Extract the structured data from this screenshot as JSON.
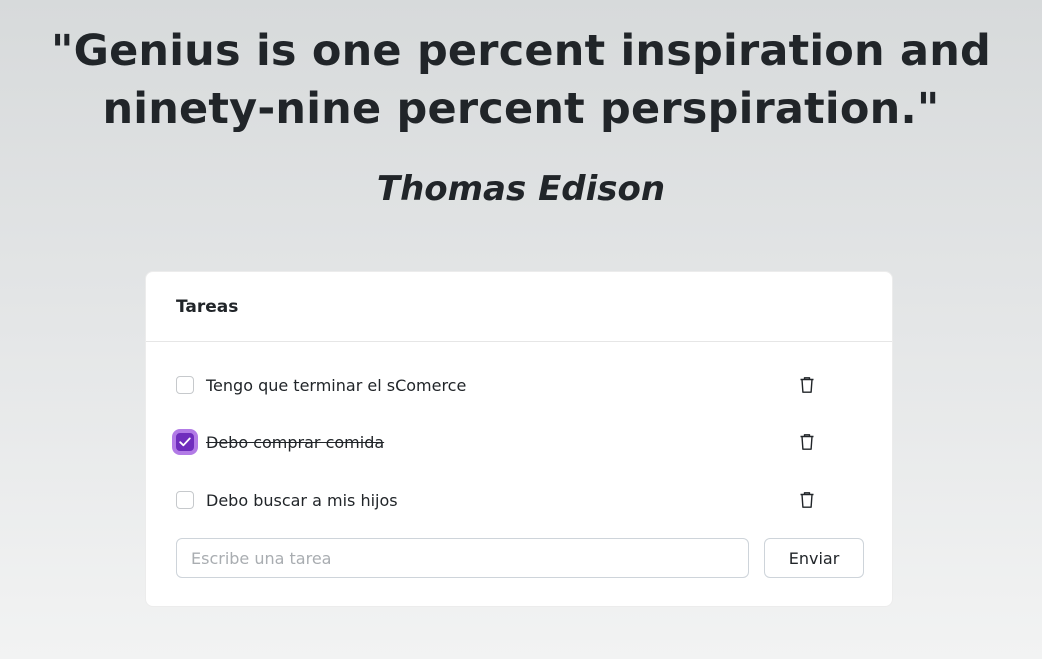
{
  "quote": {
    "text": "\"Genius is one percent inspiration and ninety-nine percent perspiration.\"",
    "author": "Thomas Edison"
  },
  "card": {
    "title": "Tareas",
    "tasks": [
      {
        "label": "Tengo que terminar el sComerce",
        "done": false,
        "delete_icon": "trash-icon"
      },
      {
        "label": "Debo comprar comida",
        "done": true,
        "delete_icon": "trash-icon"
      },
      {
        "label": "Debo buscar a mis hijos",
        "done": false,
        "delete_icon": "trash-icon"
      }
    ],
    "input": {
      "value": "",
      "placeholder": "Escribe una tarea"
    },
    "send_label": "Enviar"
  },
  "colors": {
    "accent": "#6f2dbd",
    "focus_ring": "#b27be6",
    "text": "#212529"
  }
}
